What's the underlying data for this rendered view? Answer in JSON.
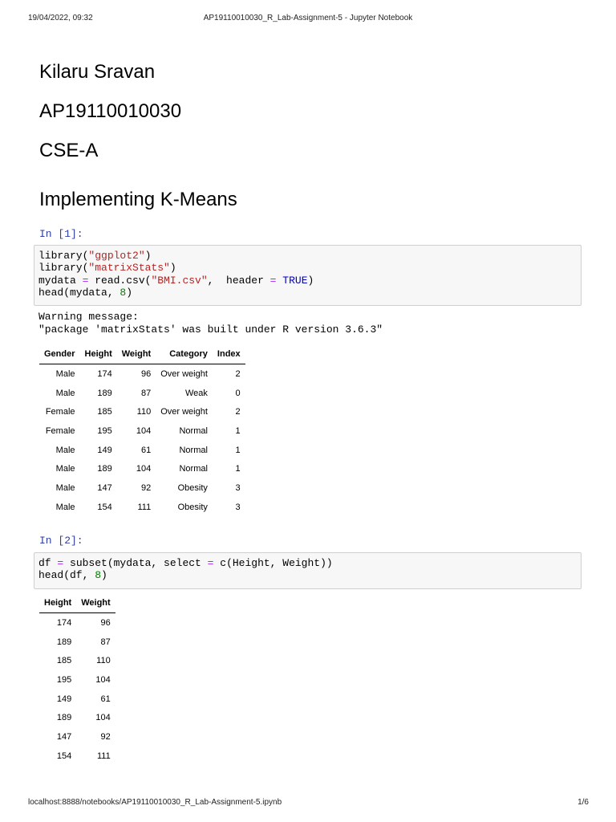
{
  "print_header": {
    "timestamp": "19/04/2022, 09:32",
    "title": "AP19110010030_R_Lab-Assignment-5 - Jupyter Notebook"
  },
  "print_footer": {
    "url": "localhost:8888/notebooks/AP19110010030_R_Lab-Assignment-5.ipynb",
    "page": "1/6"
  },
  "markdown": {
    "name": "Kilaru Sravan",
    "roll": "AP19110010030",
    "section": "CSE-A",
    "heading": "Implementing K-Means"
  },
  "cell1": {
    "prompt": "In [1]:",
    "code": {
      "lib1_fn": "library(",
      "lib1_arg": "\"ggplot2\"",
      "lib1_close": ")",
      "lib2_fn": "library(",
      "lib2_arg": "\"matrixStats\"",
      "lib2_close": ")",
      "line3_a": "mydata ",
      "line3_op": "=",
      "line3_b": " read.csv(",
      "line3_str": "\"BMI.csv\"",
      "line3_c": ",  header ",
      "line3_op2": "=",
      "line3_sp": " ",
      "line3_kw": "TRUE",
      "line3_d": ")",
      "line4_a": "head(mydata, ",
      "line4_num": "8",
      "line4_b": ")"
    },
    "stderr": "Warning message:\n\"package 'matrixStats' was built under R version 3.6.3\"",
    "table": {
      "columns": [
        "Gender",
        "Height",
        "Weight",
        "Category",
        "Index"
      ],
      "rows": [
        [
          "Male",
          "174",
          "96",
          "Over weight",
          "2"
        ],
        [
          "Male",
          "189",
          "87",
          "Weak",
          "0"
        ],
        [
          "Female",
          "185",
          "110",
          "Over weight",
          "2"
        ],
        [
          "Female",
          "195",
          "104",
          "Normal",
          "1"
        ],
        [
          "Male",
          "149",
          "61",
          "Normal",
          "1"
        ],
        [
          "Male",
          "189",
          "104",
          "Normal",
          "1"
        ],
        [
          "Male",
          "147",
          "92",
          "Obesity",
          "3"
        ],
        [
          "Male",
          "154",
          "111",
          "Obesity",
          "3"
        ]
      ]
    }
  },
  "cell2": {
    "prompt": "In [2]:",
    "code": {
      "line1_a": "df ",
      "line1_op": "=",
      "line1_b": " subset(mydata, select ",
      "line1_op2": "=",
      "line1_c": " c(Height, Weight))",
      "line2_a": "head(df, ",
      "line2_num": "8",
      "line2_b": ")"
    },
    "table": {
      "columns": [
        "Height",
        "Weight"
      ],
      "rows": [
        [
          "174",
          "96"
        ],
        [
          "189",
          "87"
        ],
        [
          "185",
          "110"
        ],
        [
          "195",
          "104"
        ],
        [
          "149",
          "61"
        ],
        [
          "189",
          "104"
        ],
        [
          "147",
          "92"
        ],
        [
          "154",
          "111"
        ]
      ]
    }
  }
}
